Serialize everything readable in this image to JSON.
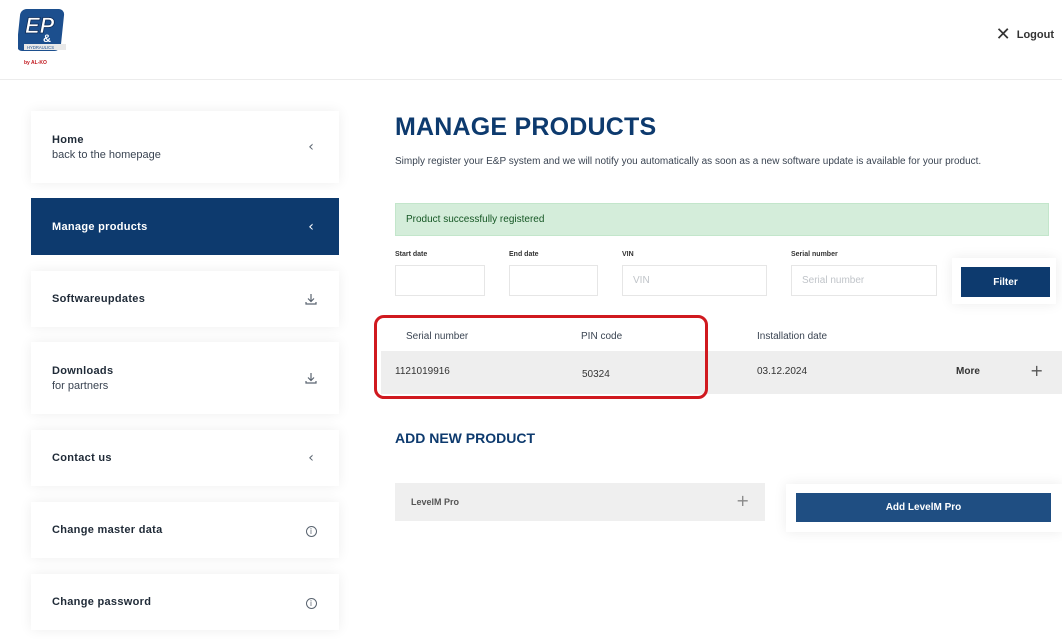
{
  "header": {
    "logo_text_main": "EP",
    "logo_text_amp": "&",
    "logo_text_sub": "HYDRAULICS",
    "logo_text_by": "by AL-KO",
    "logout_label": "Logout",
    "logout_icon": "close-icon"
  },
  "sidebar": {
    "items": [
      {
        "title": "Home",
        "sub": "back to the homepage",
        "icon": "chevron-left-icon",
        "active": false
      },
      {
        "title": "Manage products",
        "sub": "",
        "icon": "chevron-left-icon",
        "active": true
      },
      {
        "title": "Softwareupdates",
        "sub": "",
        "icon": "download-icon",
        "active": false
      },
      {
        "title": "Downloads",
        "sub": "for partners",
        "icon": "download-icon",
        "active": false
      },
      {
        "title": "Contact us",
        "sub": "",
        "icon": "chevron-left-icon",
        "active": false
      },
      {
        "title": "Change master data",
        "sub": "",
        "icon": "info-icon",
        "active": false
      },
      {
        "title": "Change password",
        "sub": "",
        "icon": "info-icon",
        "active": false
      }
    ]
  },
  "main": {
    "title": "MANAGE PRODUCTS",
    "description": "Simply register your E&P system and we will notify you automatically as soon as a new software update is available for your product.",
    "alert": "Product successfully registered",
    "filters": {
      "start_date_label": "Start date",
      "end_date_label": "End date",
      "vin_label": "VIN",
      "vin_placeholder": "VIN",
      "serial_label": "Serial number",
      "serial_placeholder": "Serial number",
      "filter_button": "Filter"
    },
    "table": {
      "columns": [
        "Serial number",
        "PIN code",
        "Installation date"
      ],
      "rows": [
        {
          "serial": "1121019916",
          "pin": "50324",
          "date": "03.12.2024",
          "more": "More"
        }
      ]
    },
    "add_section": {
      "title": "ADD NEW PRODUCT",
      "accordion_label": "LevelM Pro",
      "add_button": "Add LevelM Pro"
    }
  },
  "colors": {
    "brand_navy": "#0d3a6e",
    "button_blue": "#1f4e82",
    "success_bg": "#d4edda",
    "highlight_red": "#d0191f"
  }
}
